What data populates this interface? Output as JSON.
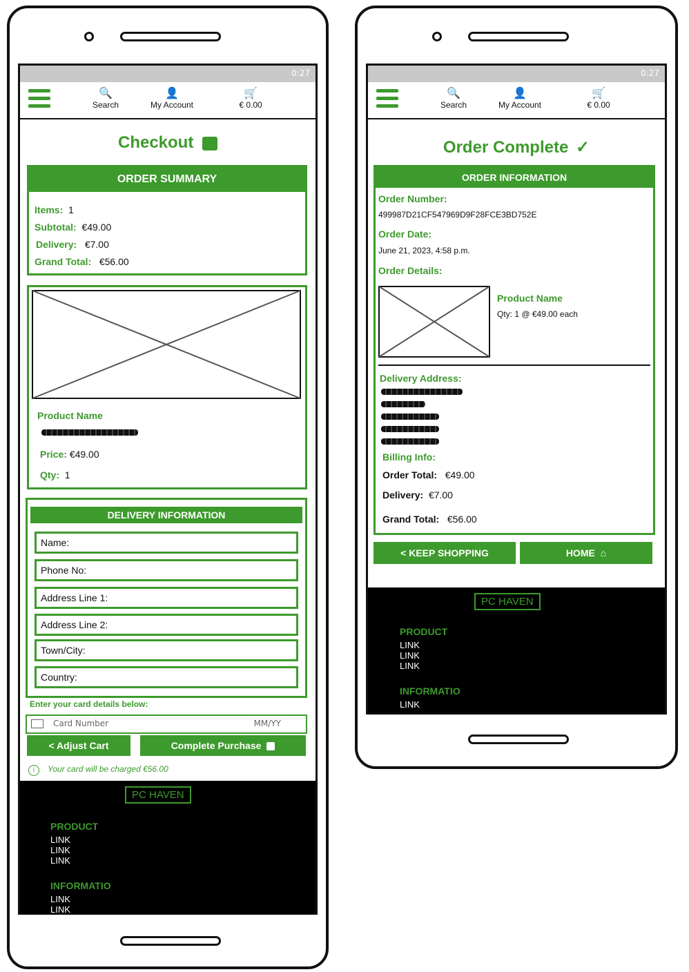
{
  "status": {
    "time": "0:27"
  },
  "nav": {
    "search_label": "Search",
    "account_label": "My Account",
    "cart_label": "€ 0.00"
  },
  "checkout": {
    "title": "Checkout",
    "summary": {
      "header": "ORDER SUMMARY",
      "items_label": "Items:",
      "items_value": "1",
      "subtotal_label": "Subtotal:",
      "subtotal_value": "€49.00",
      "delivery_label": "Delivery:",
      "delivery_value": "€7.00",
      "grand_label": "Grand Total:",
      "grand_value": "€56.00"
    },
    "product": {
      "name_label": "Product Name",
      "price_label": "Price:",
      "price_value": "€49.00",
      "qty_label": "Qty:",
      "qty_value": "1"
    },
    "delivery_info": {
      "header": "DELIVERY INFORMATION",
      "fields": [
        "Name:",
        "Phone No:",
        "Address Line 1:",
        "Address Line 2:",
        "Town/City:",
        "Country:"
      ]
    },
    "card": {
      "prompt": "Enter your card details below:",
      "number_placeholder": "Card Number",
      "expiry_placeholder": "MM/YY"
    },
    "adjust_cart_label": "< Adjust Cart",
    "complete_label": "Complete Purchase",
    "charge_note": "Your card will be charged €56.00"
  },
  "complete": {
    "title": "Order Complete",
    "info_header": "ORDER INFORMATION",
    "order_number_label": "Order Number:",
    "order_number_value": "499987D21CF547969D9F28FCE3BD752E",
    "order_date_label": "Order Date:",
    "order_date_value": "June 21, 2023, 4:58 p.m.",
    "order_details_label": "Order Details:",
    "product_name": "Product Name",
    "product_qty": "Qty: 1 @ €49.00 each",
    "delivery_address_label": "Delivery Address:",
    "billing_label": "Billing Info:",
    "order_total_label": "Order Total:",
    "order_total_value": "€49.00",
    "delivery_label": "Delivery:",
    "delivery_value": "€7.00",
    "grand_label": "Grand Total:",
    "grand_value": "€56.00",
    "keep_shopping_label": "< KEEP SHOPPING",
    "home_label": "HOME"
  },
  "footer": {
    "brand": "PC HAVEN",
    "product_heading": "PRODUCT",
    "info_heading": "INFORMATIO",
    "link": "LINK"
  },
  "colors": {
    "accent": "#3d9a2c",
    "footer_bg": "#000000"
  },
  "icons": [
    "menu-icon",
    "search-icon",
    "account-icon",
    "cart-icon",
    "bag-icon",
    "check-icon",
    "home-icon",
    "info-icon",
    "card-icon"
  ]
}
